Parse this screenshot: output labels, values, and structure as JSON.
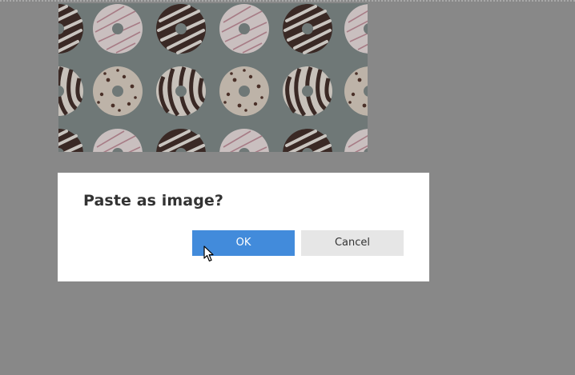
{
  "dialog": {
    "title": "Paste as image?",
    "ok_label": "OK",
    "cancel_label": "Cancel"
  },
  "colors": {
    "overlay": "#888888",
    "dialog_background": "#ffffff",
    "ok_button": "#428bdb",
    "cancel_button": "#e6e6e6",
    "title_text": "#333333"
  },
  "icons": {
    "cursor": "mouse-pointer-icon"
  }
}
